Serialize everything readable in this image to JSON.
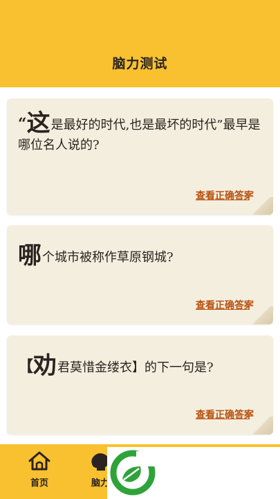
{
  "header": {
    "title": "脑力测试"
  },
  "cards": [
    {
      "q_open": "“",
      "q_big": "这",
      "q_rest": "是最好的时代,也是最坏的时代”最早是哪位名人说的?",
      "link": "查看正确答案"
    },
    {
      "q_big": "哪",
      "q_rest": "个城市被称作草原钢城?",
      "link": "查看正确答案"
    },
    {
      "q_open": "【",
      "q_big": "劝",
      "q_rest": "君莫惜金缕衣】的下一句是?",
      "link": "查看正确答案"
    }
  ],
  "tabbar": {
    "home_label": "首页",
    "brain_label": "脑力"
  },
  "colors": {
    "header_bg": "#f9c12f",
    "card_bg": "#f4eedf",
    "link": "#b8520f",
    "logo_green": "#2fa33a"
  }
}
